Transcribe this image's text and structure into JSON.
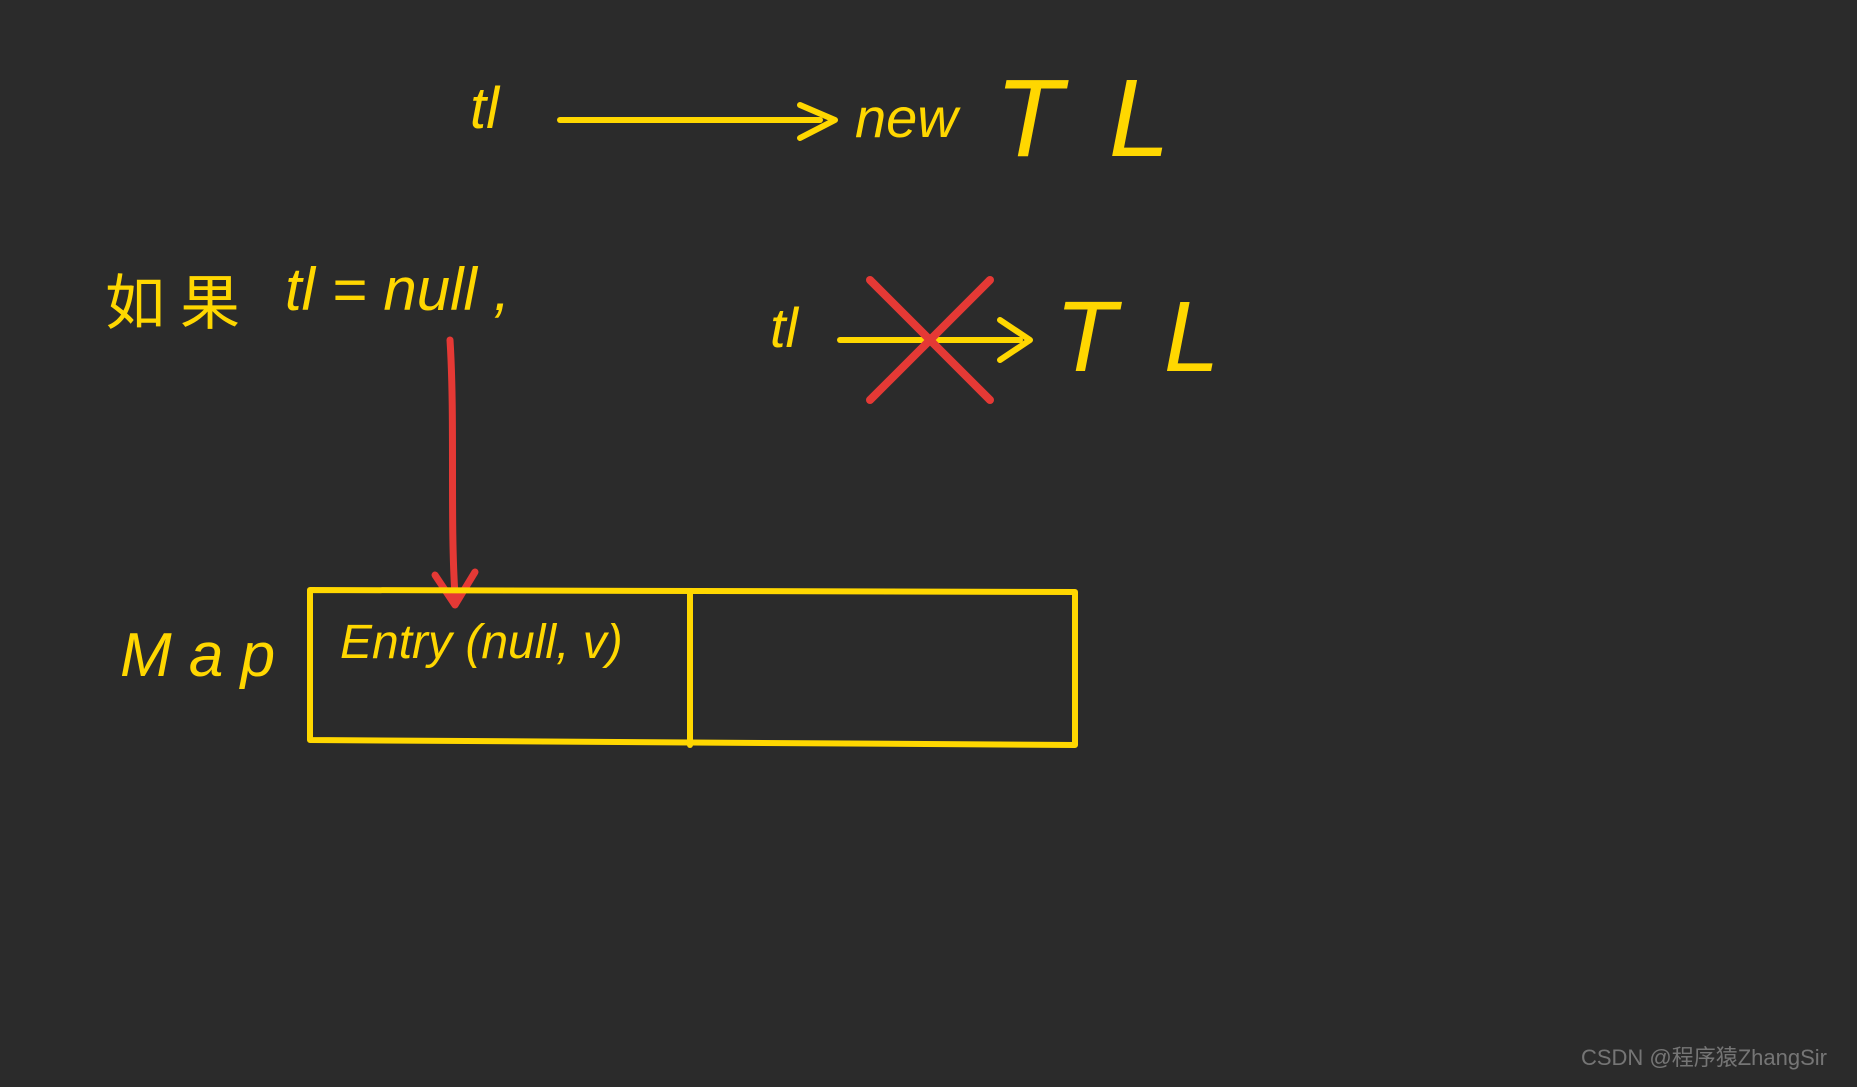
{
  "top": {
    "tl_label": "tl",
    "new_label": "new",
    "TL_big": "T L"
  },
  "condition": {
    "prefix_cn": "如 果",
    "expr": "tl = null ,"
  },
  "mid": {
    "tl_label": "tl",
    "TL_big": "T L"
  },
  "map": {
    "label": "M a p",
    "entry": "Entry (null, v)"
  },
  "watermark": "CSDN @程序猿ZhangSir",
  "colors": {
    "yellow": "#ffd700",
    "red": "#e53935",
    "bg": "#2b2b2b"
  }
}
